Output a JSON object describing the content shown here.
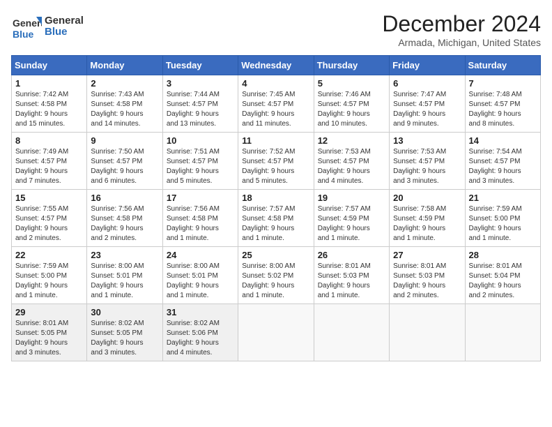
{
  "header": {
    "logo_general": "General",
    "logo_blue": "Blue",
    "month_title": "December 2024",
    "location": "Armada, Michigan, United States"
  },
  "calendar": {
    "days_of_week": [
      "Sunday",
      "Monday",
      "Tuesday",
      "Wednesday",
      "Thursday",
      "Friday",
      "Saturday"
    ],
    "weeks": [
      [
        {
          "day": "",
          "info": ""
        },
        {
          "day": "2",
          "info": "Sunrise: 7:43 AM\nSunset: 4:58 PM\nDaylight: 9 hours and 14 minutes."
        },
        {
          "day": "3",
          "info": "Sunrise: 7:44 AM\nSunset: 4:57 PM\nDaylight: 9 hours and 13 minutes."
        },
        {
          "day": "4",
          "info": "Sunrise: 7:45 AM\nSunset: 4:57 PM\nDaylight: 9 hours and 11 minutes."
        },
        {
          "day": "5",
          "info": "Sunrise: 7:46 AM\nSunset: 4:57 PM\nDaylight: 9 hours and 10 minutes."
        },
        {
          "day": "6",
          "info": "Sunrise: 7:47 AM\nSunset: 4:57 PM\nDaylight: 9 hours and 9 minutes."
        },
        {
          "day": "7",
          "info": "Sunrise: 7:48 AM\nSunset: 4:57 PM\nDaylight: 9 hours and 8 minutes."
        }
      ],
      [
        {
          "day": "1",
          "info": "Sunrise: 7:42 AM\nSunset: 4:58 PM\nDaylight: 9 hours and 15 minutes.",
          "first_row_sunday": true
        },
        {
          "day": "9",
          "info": "Sunrise: 7:50 AM\nSunset: 4:57 PM\nDaylight: 9 hours and 6 minutes."
        },
        {
          "day": "10",
          "info": "Sunrise: 7:51 AM\nSunset: 4:57 PM\nDaylight: 9 hours and 5 minutes."
        },
        {
          "day": "11",
          "info": "Sunrise: 7:52 AM\nSunset: 4:57 PM\nDaylight: 9 hours and 5 minutes."
        },
        {
          "day": "12",
          "info": "Sunrise: 7:53 AM\nSunset: 4:57 PM\nDaylight: 9 hours and 4 minutes."
        },
        {
          "day": "13",
          "info": "Sunrise: 7:53 AM\nSunset: 4:57 PM\nDaylight: 9 hours and 3 minutes."
        },
        {
          "day": "14",
          "info": "Sunrise: 7:54 AM\nSunset: 4:57 PM\nDaylight: 9 hours and 3 minutes."
        }
      ],
      [
        {
          "day": "8",
          "info": "Sunrise: 7:49 AM\nSunset: 4:57 PM\nDaylight: 9 hours and 7 minutes.",
          "week3_sunday": true
        },
        {
          "day": "16",
          "info": "Sunrise: 7:56 AM\nSunset: 4:58 PM\nDaylight: 9 hours and 2 minutes."
        },
        {
          "day": "17",
          "info": "Sunrise: 7:56 AM\nSunset: 4:58 PM\nDaylight: 9 hours and 1 minute."
        },
        {
          "day": "18",
          "info": "Sunrise: 7:57 AM\nSunset: 4:58 PM\nDaylight: 9 hours and 1 minute."
        },
        {
          "day": "19",
          "info": "Sunrise: 7:57 AM\nSunset: 4:59 PM\nDaylight: 9 hours and 1 minute."
        },
        {
          "day": "20",
          "info": "Sunrise: 7:58 AM\nSunset: 4:59 PM\nDaylight: 9 hours and 1 minute."
        },
        {
          "day": "21",
          "info": "Sunrise: 7:59 AM\nSunset: 5:00 PM\nDaylight: 9 hours and 1 minute."
        }
      ],
      [
        {
          "day": "15",
          "info": "Sunrise: 7:55 AM\nSunset: 4:57 PM\nDaylight: 9 hours and 2 minutes.",
          "week4_sunday": true
        },
        {
          "day": "23",
          "info": "Sunrise: 8:00 AM\nSunset: 5:01 PM\nDaylight: 9 hours and 1 minute."
        },
        {
          "day": "24",
          "info": "Sunrise: 8:00 AM\nSunset: 5:01 PM\nDaylight: 9 hours and 1 minute."
        },
        {
          "day": "25",
          "info": "Sunrise: 8:00 AM\nSunset: 5:02 PM\nDaylight: 9 hours and 1 minute."
        },
        {
          "day": "26",
          "info": "Sunrise: 8:01 AM\nSunset: 5:03 PM\nDaylight: 9 hours and 1 minute."
        },
        {
          "day": "27",
          "info": "Sunrise: 8:01 AM\nSunset: 5:03 PM\nDaylight: 9 hours and 2 minutes."
        },
        {
          "day": "28",
          "info": "Sunrise: 8:01 AM\nSunset: 5:04 PM\nDaylight: 9 hours and 2 minutes."
        }
      ],
      [
        {
          "day": "22",
          "info": "Sunrise: 7:59 AM\nSunset: 5:00 PM\nDaylight: 9 hours and 1 minute.",
          "week5_sunday": true
        },
        {
          "day": "30",
          "info": "Sunrise: 8:02 AM\nSunset: 5:05 PM\nDaylight: 9 hours and 3 minutes."
        },
        {
          "day": "31",
          "info": "Sunrise: 8:02 AM\nSunset: 5:06 PM\nDaylight: 9 hours and 4 minutes."
        },
        {
          "day": "",
          "info": ""
        },
        {
          "day": "",
          "info": ""
        },
        {
          "day": "",
          "info": ""
        },
        {
          "day": "",
          "info": ""
        }
      ],
      [
        {
          "day": "29",
          "info": "Sunrise: 8:01 AM\nSunset: 5:05 PM\nDaylight: 9 hours and 3 minutes.",
          "week6_sunday": true
        },
        {
          "day": "",
          "info": ""
        },
        {
          "day": "",
          "info": ""
        },
        {
          "day": "",
          "info": ""
        },
        {
          "day": "",
          "info": ""
        },
        {
          "day": "",
          "info": ""
        },
        {
          "day": "",
          "info": ""
        }
      ]
    ]
  }
}
